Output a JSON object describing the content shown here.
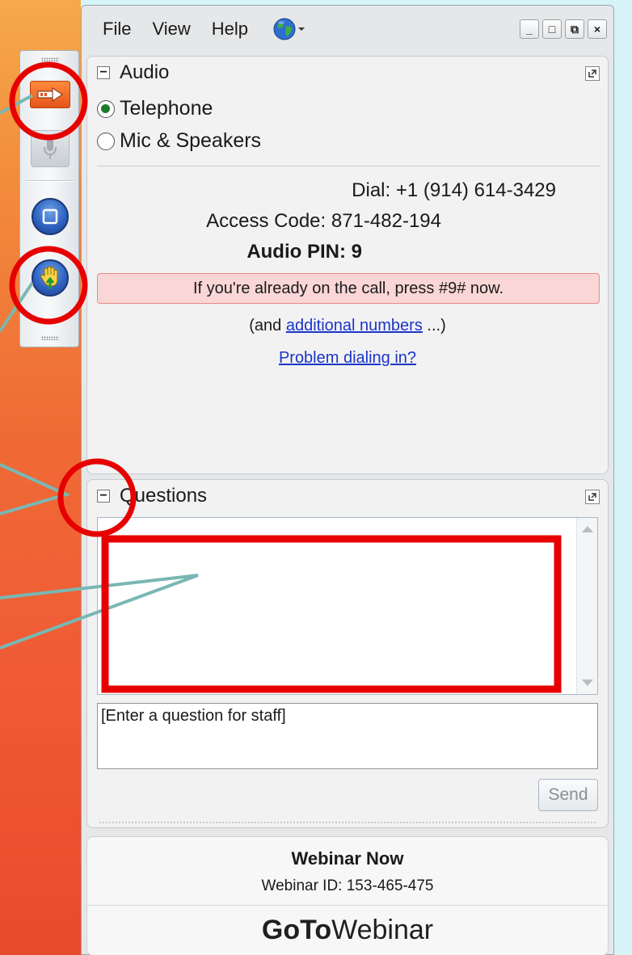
{
  "menubar": {
    "file": "File",
    "view": "View",
    "help": "Help"
  },
  "window_controls": {
    "minimize": "_",
    "maximize": "□",
    "restore": "⧉",
    "close": "×"
  },
  "audio": {
    "title": "Audio",
    "telephone_label": "Telephone",
    "mic_label": "Mic & Speakers",
    "selected": "Telephone",
    "dial_label": "Dial:",
    "dial_number": "+1 (914) 614-3429",
    "access_label": "Access Code:",
    "access_code": "871-482-194",
    "pin_label": "Audio PIN:",
    "pin": "9",
    "alert": "If you're already on the call, press #9# now.",
    "additional_prefix": "(and",
    "additional_link": "additional numbers",
    "additional_suffix": "...)",
    "problem_link": "Problem dialing in?"
  },
  "questions": {
    "title": "Questions",
    "input_placeholder": "[Enter a question for staff]",
    "send_label": "Send"
  },
  "footer": {
    "webinar_name": "Webinar Now",
    "webinar_id": "Webinar ID: 153-465-475",
    "brand_bold": "GoTo",
    "brand_light": "Webinar"
  },
  "colors": {
    "background": "#d6f4f8",
    "annotation_red": "#e60000",
    "annotation_line": "#79b7b4",
    "link": "#1a35c9",
    "alert_bg": "#fbd6d6"
  },
  "icons": [
    "globe-icon",
    "show-hide-arrow-icon",
    "microphone-icon",
    "screen-icon",
    "raise-hand-icon",
    "popout-icon",
    "collapse-icon"
  ]
}
